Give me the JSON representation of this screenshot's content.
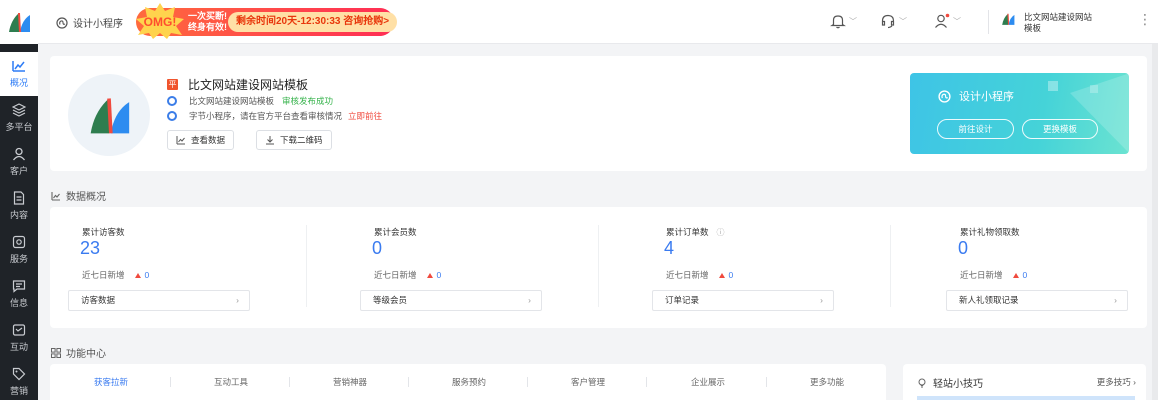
{
  "sidebar": {
    "items": [
      {
        "label": "概况",
        "icon": "chart-icon"
      },
      {
        "label": "多平台",
        "icon": "layers-icon"
      },
      {
        "label": "客户",
        "icon": "user-icon"
      },
      {
        "label": "内容",
        "icon": "document-icon"
      },
      {
        "label": "服务",
        "icon": "service-icon"
      },
      {
        "label": "信息",
        "icon": "message-icon"
      },
      {
        "label": "互动",
        "icon": "interact-icon"
      },
      {
        "label": "营销",
        "icon": "tag-icon"
      }
    ]
  },
  "topbar": {
    "mini_program_label": "设计小程序",
    "promo": {
      "badge": "OMG!",
      "line1": "一次买断!",
      "line2": "终身有效!",
      "countdown": "剩余时间20天-12:30:33 咨询抢购>"
    },
    "site_name": "比文网站建设网站模板"
  },
  "site_card": {
    "tag": "平",
    "title": "比文网站建设网站模板",
    "line1_text": "比文网站建设网站模板",
    "line1_status": "审核发布成功",
    "line2_text": "字节小程序，请在官方平台查看审核情况",
    "line2_link": "立即前往",
    "btn_view_data": "查看数据",
    "btn_download_qr": "下载二维码"
  },
  "mini_program_card": {
    "title": "设计小程序",
    "btn_design": "前往设计",
    "btn_change": "更换模板"
  },
  "data_overview": {
    "title": "数据概况",
    "week_label": "近七日新增",
    "stats": [
      {
        "label": "累计访客数",
        "value": "23",
        "week": "0",
        "button": "访客数据"
      },
      {
        "label": "累计会员数",
        "value": "0",
        "week": "0",
        "button": "等级会员"
      },
      {
        "label": "累计订单数",
        "value": "4",
        "week": "0",
        "button": "订单记录"
      },
      {
        "label": "累计礼物领取数",
        "value": "0",
        "week": "0",
        "button": "新人礼领取记录"
      }
    ]
  },
  "function_center": {
    "title": "功能中心",
    "tabs": [
      "获客拉新",
      "互动工具",
      "营销神器",
      "服务预约",
      "客户管理",
      "企业展示",
      "更多功能"
    ]
  },
  "tips": {
    "title": "轻站小技巧",
    "more": "更多技巧"
  },
  "colors": {
    "accent": "#3a7bf0",
    "sidebar_bg": "#1f2328",
    "success": "#34b24a",
    "danger": "#f04a3e"
  }
}
